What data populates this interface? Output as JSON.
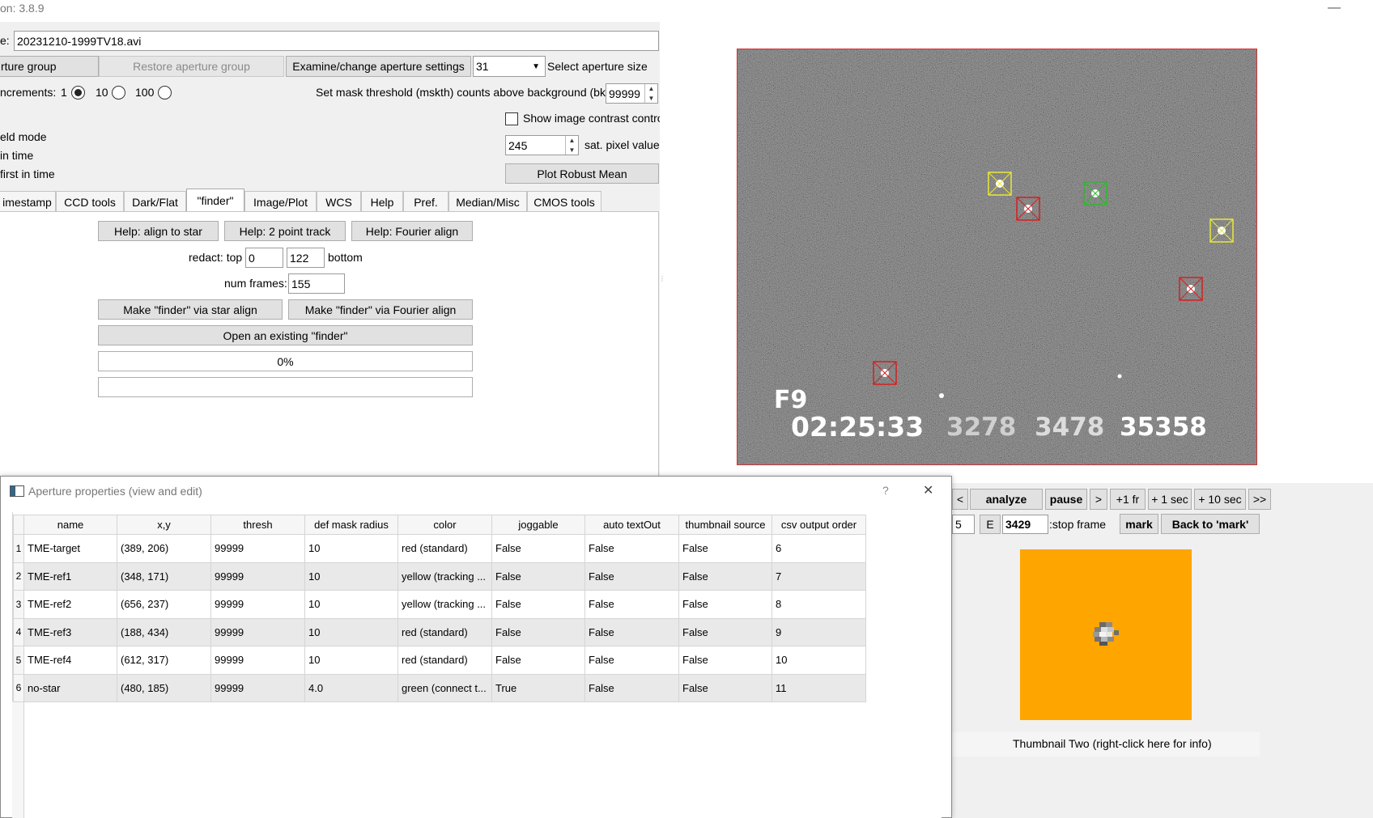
{
  "window": {
    "title": "on: 3.8.9",
    "minimize": "—"
  },
  "file": {
    "label": "e:",
    "value": "20231210-1999TV18.avi"
  },
  "aperture_row": {
    "save_group": "rture group",
    "restore_group": "Restore aperture group",
    "examine_settings": "Examine/change aperture settings",
    "size_value": "31",
    "size_label": "Select aperture size"
  },
  "increments": {
    "label": "ncrements:",
    "opts": [
      "1",
      "10",
      "100"
    ],
    "selected": 0
  },
  "mask": {
    "label": "Set mask threshold (mskth) counts above background (bkavg)",
    "value": "99999"
  },
  "contrast": {
    "label": "Show image contrast control"
  },
  "left_options": [
    "eld mode",
    " in time",
    "first in time"
  ],
  "sat": {
    "value": "245",
    "label": "sat. pixel value"
  },
  "plot_robust_mean": "Plot Robust Mean",
  "tabs": [
    "imestamp",
    "CCD tools",
    "Dark/Flat",
    "\"finder\"",
    "Image/Plot",
    "WCS",
    "Help",
    "Pref.",
    "Median/Misc",
    "CMOS tools"
  ],
  "finder": {
    "help_align": "Help: align to star",
    "help_2pt": "Help: 2 point track",
    "help_fourier": "Help: Fourier align",
    "redact_label": "redact: top",
    "redact_top": "0",
    "redact_bottom": "122",
    "bottom_label": "bottom",
    "numframes_label": "num frames:",
    "numframes": "155",
    "make_star": "Make \"finder\" via star align",
    "make_fourier": "Make \"finder\" via Fourier align",
    "open_existing": "Open an existing  \"finder\"",
    "progress_text": "0%"
  },
  "video": {
    "line1": "F9",
    "time": "02:25:33",
    "n1": "3278",
    "n2": "3478",
    "n3": "35358"
  },
  "player": {
    "prev": "<",
    "analyze": "analyze",
    "pause": "pause",
    "next": ">",
    "plus1fr": "+1 fr",
    "plus1sec": "+ 1 sec",
    "plus10sec": "+ 10 sec",
    "fastfwd": ">>",
    "start_frame": "5",
    "e_label": "E",
    "stop_value": "3429",
    "stop_label": ":stop frame",
    "mark": "mark",
    "back_mark": "Back to 'mark'"
  },
  "thumbnail": {
    "caption": "Thumbnail Two (right-click here for info)",
    "color": "#ffa500"
  },
  "dialog": {
    "title": "Aperture properties (view and edit)",
    "help": "?",
    "close": "✕",
    "columns": [
      "name",
      "x,y",
      "thresh",
      "def mask radius",
      "color",
      "joggable",
      "auto textOut",
      "thumbnail source",
      "csv output order"
    ],
    "rows": [
      [
        "1",
        "TME-target",
        "(389, 206)",
        "99999",
        "10",
        "red (standard)",
        "False",
        "False",
        "False",
        "6"
      ],
      [
        "2",
        "TME-ref1",
        "(348, 171)",
        "99999",
        "10",
        "yellow (tracking ...",
        "False",
        "False",
        "False",
        "7"
      ],
      [
        "3",
        "TME-ref2",
        "(656, 237)",
        "99999",
        "10",
        "yellow (tracking ...",
        "False",
        "False",
        "False",
        "8"
      ],
      [
        "4",
        "TME-ref3",
        "(188, 434)",
        "99999",
        "10",
        "red (standard)",
        "False",
        "False",
        "False",
        "9"
      ],
      [
        "5",
        "TME-ref4",
        "(612, 317)",
        "99999",
        "10",
        "red (standard)",
        "False",
        "False",
        "False",
        "10"
      ],
      [
        "6",
        "no-star",
        "(480, 185)",
        "99999",
        "4.0",
        "green (connect t...",
        "True",
        "False",
        "False",
        "11"
      ]
    ]
  },
  "colors": {
    "red": "#d32020",
    "yellow": "#e8e83a",
    "green": "#2fb82f"
  }
}
